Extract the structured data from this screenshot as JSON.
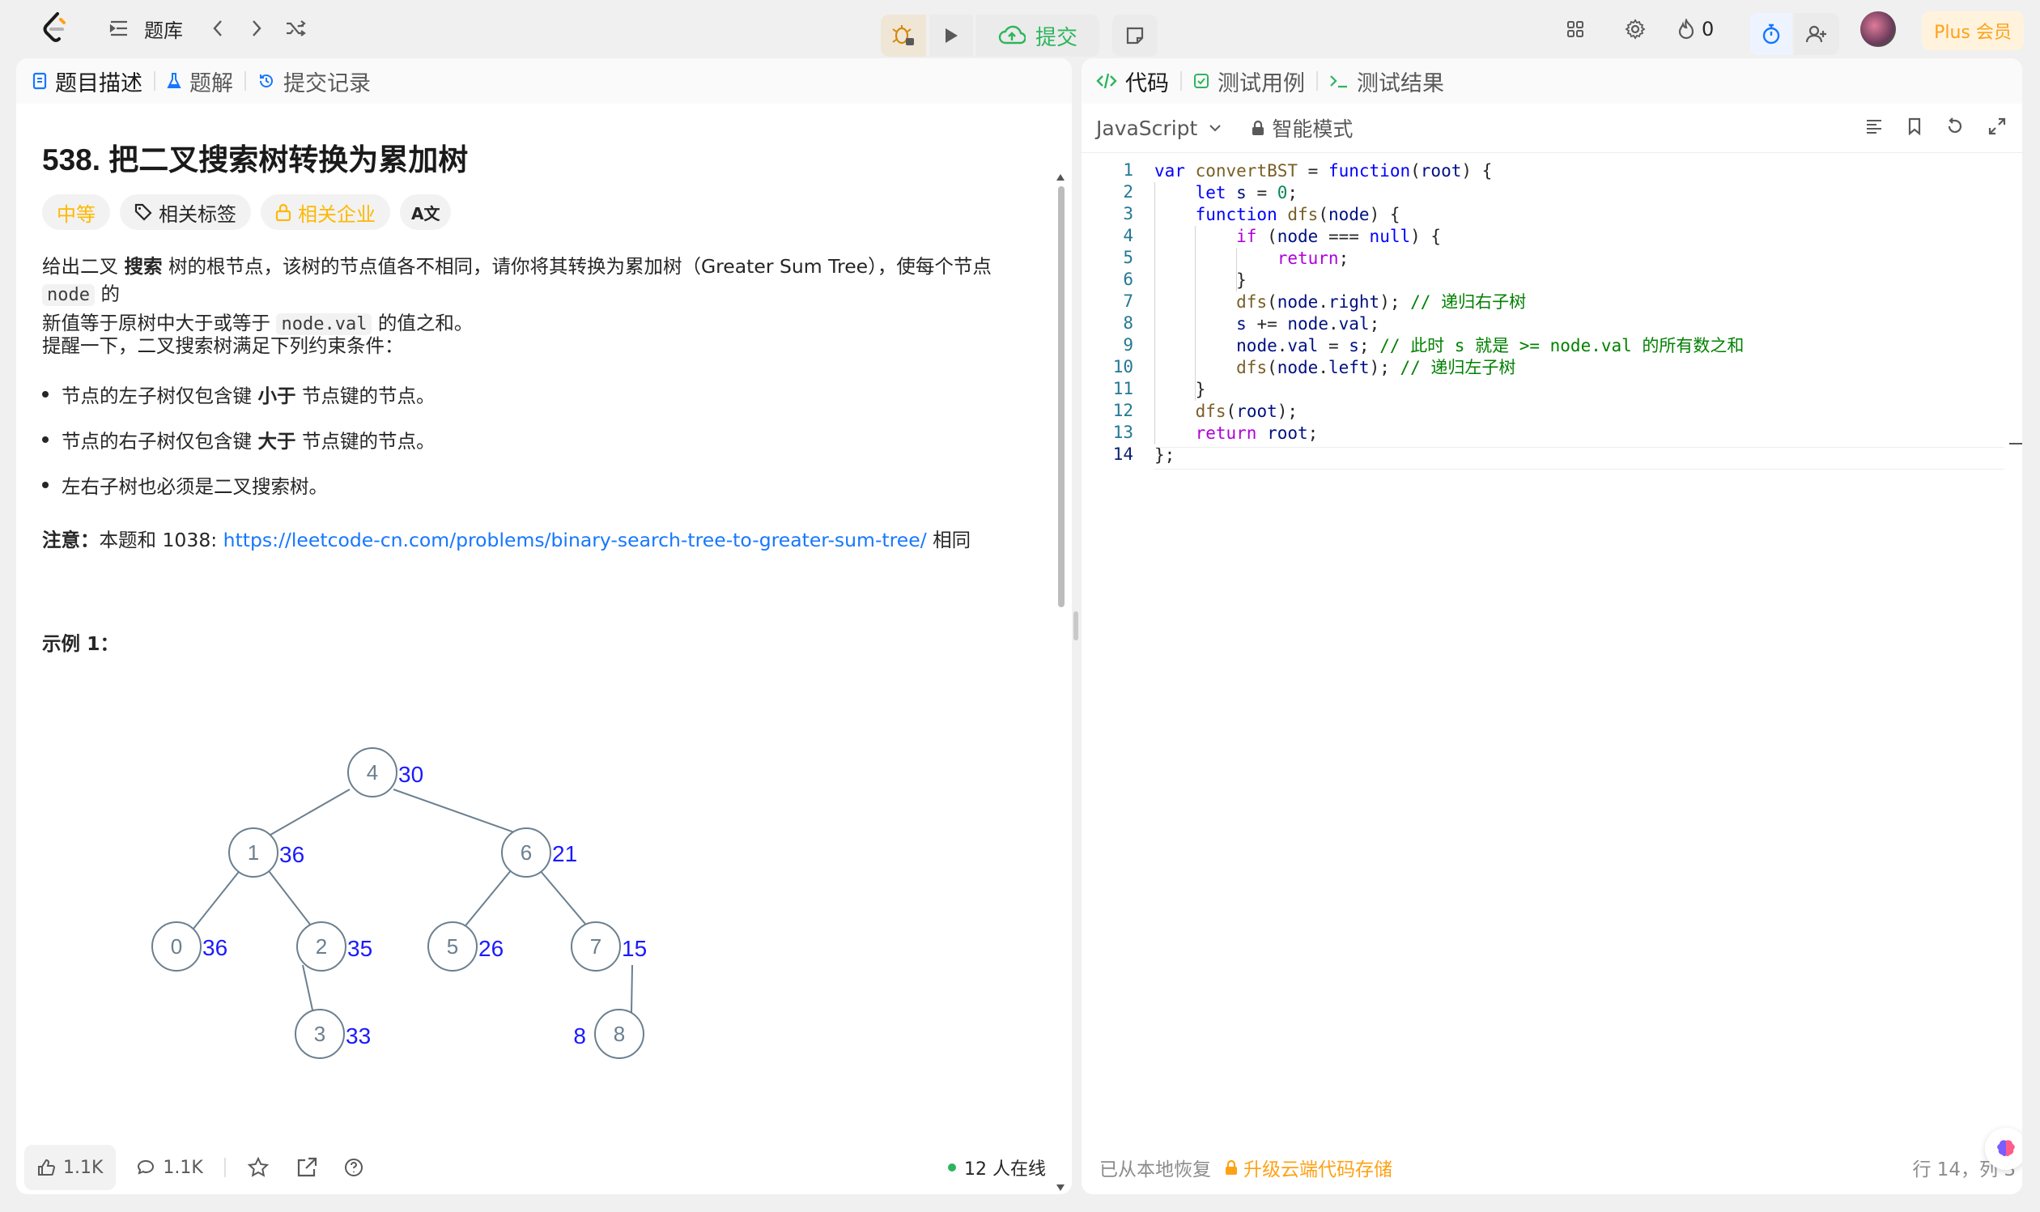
{
  "topbar": {
    "problem_bank_label": "题库",
    "submit_label": "提交",
    "streak_count": "0",
    "plus_label": "Plus 会员"
  },
  "left_tabs": [
    {
      "label": "题目描述"
    },
    {
      "label": "题解"
    },
    {
      "label": "提交记录"
    }
  ],
  "problem": {
    "title": "538. 把二叉搜索树转换为累加树",
    "difficulty": "中等",
    "tags_label": "相关标签",
    "company_label": "相关企业",
    "translate_glyph": "A文",
    "desc_p1_a": "给出二叉 ",
    "desc_p1_bold": "搜索",
    "desc_p1_b": " 树的根节点，该树的节点值各不相同，请你将其转换为累加树（Greater Sum Tree），使每个节点 ",
    "desc_p1_code1": "node",
    "desc_p1_c": " 的",
    "desc_p1_d": "新值等于原树中大于或等于 ",
    "desc_p1_code2": "node.val",
    "desc_p1_e": " 的值之和。",
    "desc_p2": "提醒一下，二叉搜索树满足下列约束条件：",
    "bullet1_a": "节点的左子树仅包含键 ",
    "bullet1_bold": "小于",
    "bullet1_b": " 节点键的节点。",
    "bullet2_a": "节点的右子树仅包含键 ",
    "bullet2_bold": "大于",
    "bullet2_b": " 节点键的节点。",
    "bullet3": "左右子树也必须是二叉搜索树。",
    "note_bold": "注意：",
    "note_a": "本题和 1038: ",
    "note_link": "https://leetcode-cn.com/problems/binary-search-tree-to-greater-sum-tree/",
    "note_b": " 相同",
    "example_title": "示例 1："
  },
  "tree": {
    "nodes": [
      {
        "val": "4",
        "sum": "30"
      },
      {
        "val": "1",
        "sum": "36"
      },
      {
        "val": "6",
        "sum": "21"
      },
      {
        "val": "0",
        "sum": "36"
      },
      {
        "val": "2",
        "sum": "35"
      },
      {
        "val": "5",
        "sum": "26"
      },
      {
        "val": "7",
        "sum": "15"
      },
      {
        "val": "3",
        "sum": "33"
      },
      {
        "val": "8",
        "sum": "8"
      }
    ]
  },
  "left_footer": {
    "likes": "1.1K",
    "comments": "1.1K",
    "online": "12 人在线"
  },
  "right_tabs": [
    {
      "label": "代码"
    },
    {
      "label": "测试用例"
    },
    {
      "label": "测试结果"
    }
  ],
  "editor": {
    "language": "JavaScript",
    "mode": "智能模式",
    "lines": [
      "var convertBST = function(root) {",
      "    let s = 0;",
      "    function dfs(node) {",
      "        if (node === null) {",
      "            return;",
      "        }",
      "        dfs(node.right); // 递归右子树",
      "        s += node.val;",
      "        node.val = s; // 此时 s 就是 >= node.val 的所有数之和",
      "        dfs(node.left); // 递归左子树",
      "    }",
      "    dfs(root);",
      "    return root;",
      "};"
    ]
  },
  "right_footer": {
    "restored": "已从本地恢复",
    "upgrade": "升级云端代码存储",
    "position": "行 14，列 3"
  },
  "colors": {
    "accent_green": "#2db55d",
    "link_blue": "#1677ff",
    "medium_yellow": "#ffb800",
    "sum_blue": "#1a1aff"
  }
}
